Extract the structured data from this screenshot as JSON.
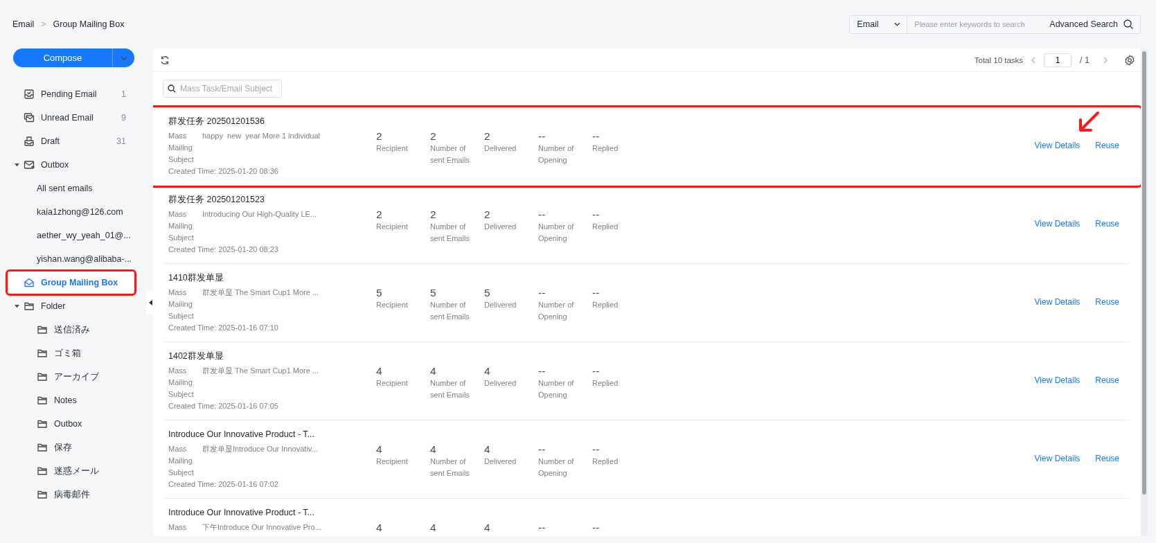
{
  "breadcrumb": [
    "Email",
    "Group Mailing Box"
  ],
  "breadcrumb_separator": ">",
  "search": {
    "scope": "Email",
    "placeholder": "Please enter keywords to search",
    "advanced_label": "Advanced Search"
  },
  "compose": {
    "label": "Compose"
  },
  "sidebar": {
    "items": [
      {
        "kind": "pending",
        "label": "Pending Email",
        "count": "1",
        "selected": false,
        "annotated": false
      },
      {
        "kind": "unread",
        "label": "Unread Email",
        "count": "9",
        "selected": false,
        "annotated": false
      },
      {
        "kind": "draft",
        "label": "Draft",
        "count": "31",
        "selected": false,
        "annotated": false
      },
      {
        "kind": "outbox",
        "label": "Outbox",
        "expanded": true,
        "selected": false,
        "annotated": false,
        "children": [
          {
            "kind": "account",
            "label": "All sent emails",
            "selected": false
          },
          {
            "kind": "account",
            "label": "kaia1zhong@126.com",
            "selected": false
          },
          {
            "kind": "account",
            "label": "aether_wy_yeah_01@...",
            "selected": false
          },
          {
            "kind": "account",
            "label": "yishan.wang@alibaba-...",
            "selected": false
          }
        ]
      },
      {
        "kind": "group-mail",
        "label": "Group Mailing Box",
        "selected": true,
        "annotated": true
      },
      {
        "kind": "folder",
        "label": "Folder",
        "expanded": true,
        "selected": false,
        "annotated": false,
        "children": [
          {
            "kind": "folder",
            "label": "送信済み",
            "selected": false
          },
          {
            "kind": "folder",
            "label": "ゴミ箱",
            "selected": false
          },
          {
            "kind": "folder",
            "label": "アーカイブ",
            "selected": false
          },
          {
            "kind": "folder",
            "label": "Notes",
            "selected": false
          },
          {
            "kind": "folder",
            "label": "Outbox",
            "selected": false
          },
          {
            "kind": "folder",
            "label": "保存",
            "selected": false
          },
          {
            "kind": "folder",
            "label": "迷惑メール",
            "selected": false
          },
          {
            "kind": "folder",
            "label": "病毒邮件",
            "selected": false
          }
        ]
      }
    ]
  },
  "toolbar": {
    "total": "Total 10 tasks",
    "page": "1",
    "pages": "/ 1"
  },
  "filter": {
    "placeholder": "Mass Task/Email Subject"
  },
  "tasks": [
    {
      "title": "群发任务 202501201536",
      "subject_label": "Mass Mailing Subject",
      "subject": "happy  new  year More 1 individual",
      "created": "Created Time: 2025-01-20 08:36",
      "annotated": true,
      "metrics": [
        {
          "value": "2",
          "label": "Recipient"
        },
        {
          "value": "2",
          "label": "Number of sent Emails"
        },
        {
          "value": "2",
          "label": "Delivered"
        },
        {
          "value": "--",
          "label": "Number of Opening"
        },
        {
          "value": "--",
          "label": "Replied"
        }
      ],
      "actions": [
        "View Details",
        "Reuse"
      ]
    },
    {
      "title": "群发任务 202501201523",
      "subject_label": "Mass Mailing Subject",
      "subject": "Introducing Our High-Quality LE...",
      "created": "Created Time: 2025-01-20 08:23",
      "annotated": false,
      "metrics": [
        {
          "value": "2",
          "label": "Recipient"
        },
        {
          "value": "2",
          "label": "Number of sent Emails"
        },
        {
          "value": "2",
          "label": "Delivered"
        },
        {
          "value": "--",
          "label": "Number of Opening"
        },
        {
          "value": "--",
          "label": "Replied"
        }
      ],
      "actions": [
        "View Details",
        "Reuse"
      ]
    },
    {
      "title": "1410群发单显",
      "subject_label": "Mass Mailing Subject",
      "subject": "群发单显 The Smart Cup1 More ...",
      "created": "Created Time: 2025-01-16 07:10",
      "annotated": false,
      "metrics": [
        {
          "value": "5",
          "label": "Recipient"
        },
        {
          "value": "5",
          "label": "Number of sent Emails"
        },
        {
          "value": "5",
          "label": "Delivered"
        },
        {
          "value": "--",
          "label": "Number of Opening"
        },
        {
          "value": "--",
          "label": "Replied"
        }
      ],
      "actions": [
        "View Details",
        "Reuse"
      ]
    },
    {
      "title": "1402群发单显",
      "subject_label": "Mass Mailing Subject",
      "subject": "群发单显 The Smart Cup1 More ...",
      "created": "Created Time: 2025-01-16 07:05",
      "annotated": false,
      "metrics": [
        {
          "value": "4",
          "label": "Recipient"
        },
        {
          "value": "4",
          "label": "Number of sent Emails"
        },
        {
          "value": "4",
          "label": "Delivered"
        },
        {
          "value": "--",
          "label": "Number of Opening"
        },
        {
          "value": "--",
          "label": "Replied"
        }
      ],
      "actions": [
        "View Details",
        "Reuse"
      ]
    },
    {
      "title": "Introduce Our Innovative Product - T...",
      "subject_label": "Mass Mailing Subject",
      "subject": "群发单显Introduce Our Innovativ...",
      "created": "Created Time: 2025-01-16 07:02",
      "annotated": false,
      "metrics": [
        {
          "value": "4",
          "label": "Recipient"
        },
        {
          "value": "4",
          "label": "Number of sent Emails"
        },
        {
          "value": "4",
          "label": "Delivered"
        },
        {
          "value": "--",
          "label": "Number of Opening"
        },
        {
          "value": "--",
          "label": "Replied"
        }
      ],
      "actions": [
        "View Details",
        "Reuse"
      ]
    },
    {
      "title": "Introduce Our Innovative Product - T...",
      "subject_label": "Mass",
      "subject": "下午Introduce Our Innovative Pro...",
      "annotated": false,
      "metrics": [
        {
          "value": "4"
        },
        {
          "value": "4"
        },
        {
          "value": "4"
        },
        {
          "value": "--"
        },
        {
          "value": "--"
        }
      ]
    }
  ]
}
